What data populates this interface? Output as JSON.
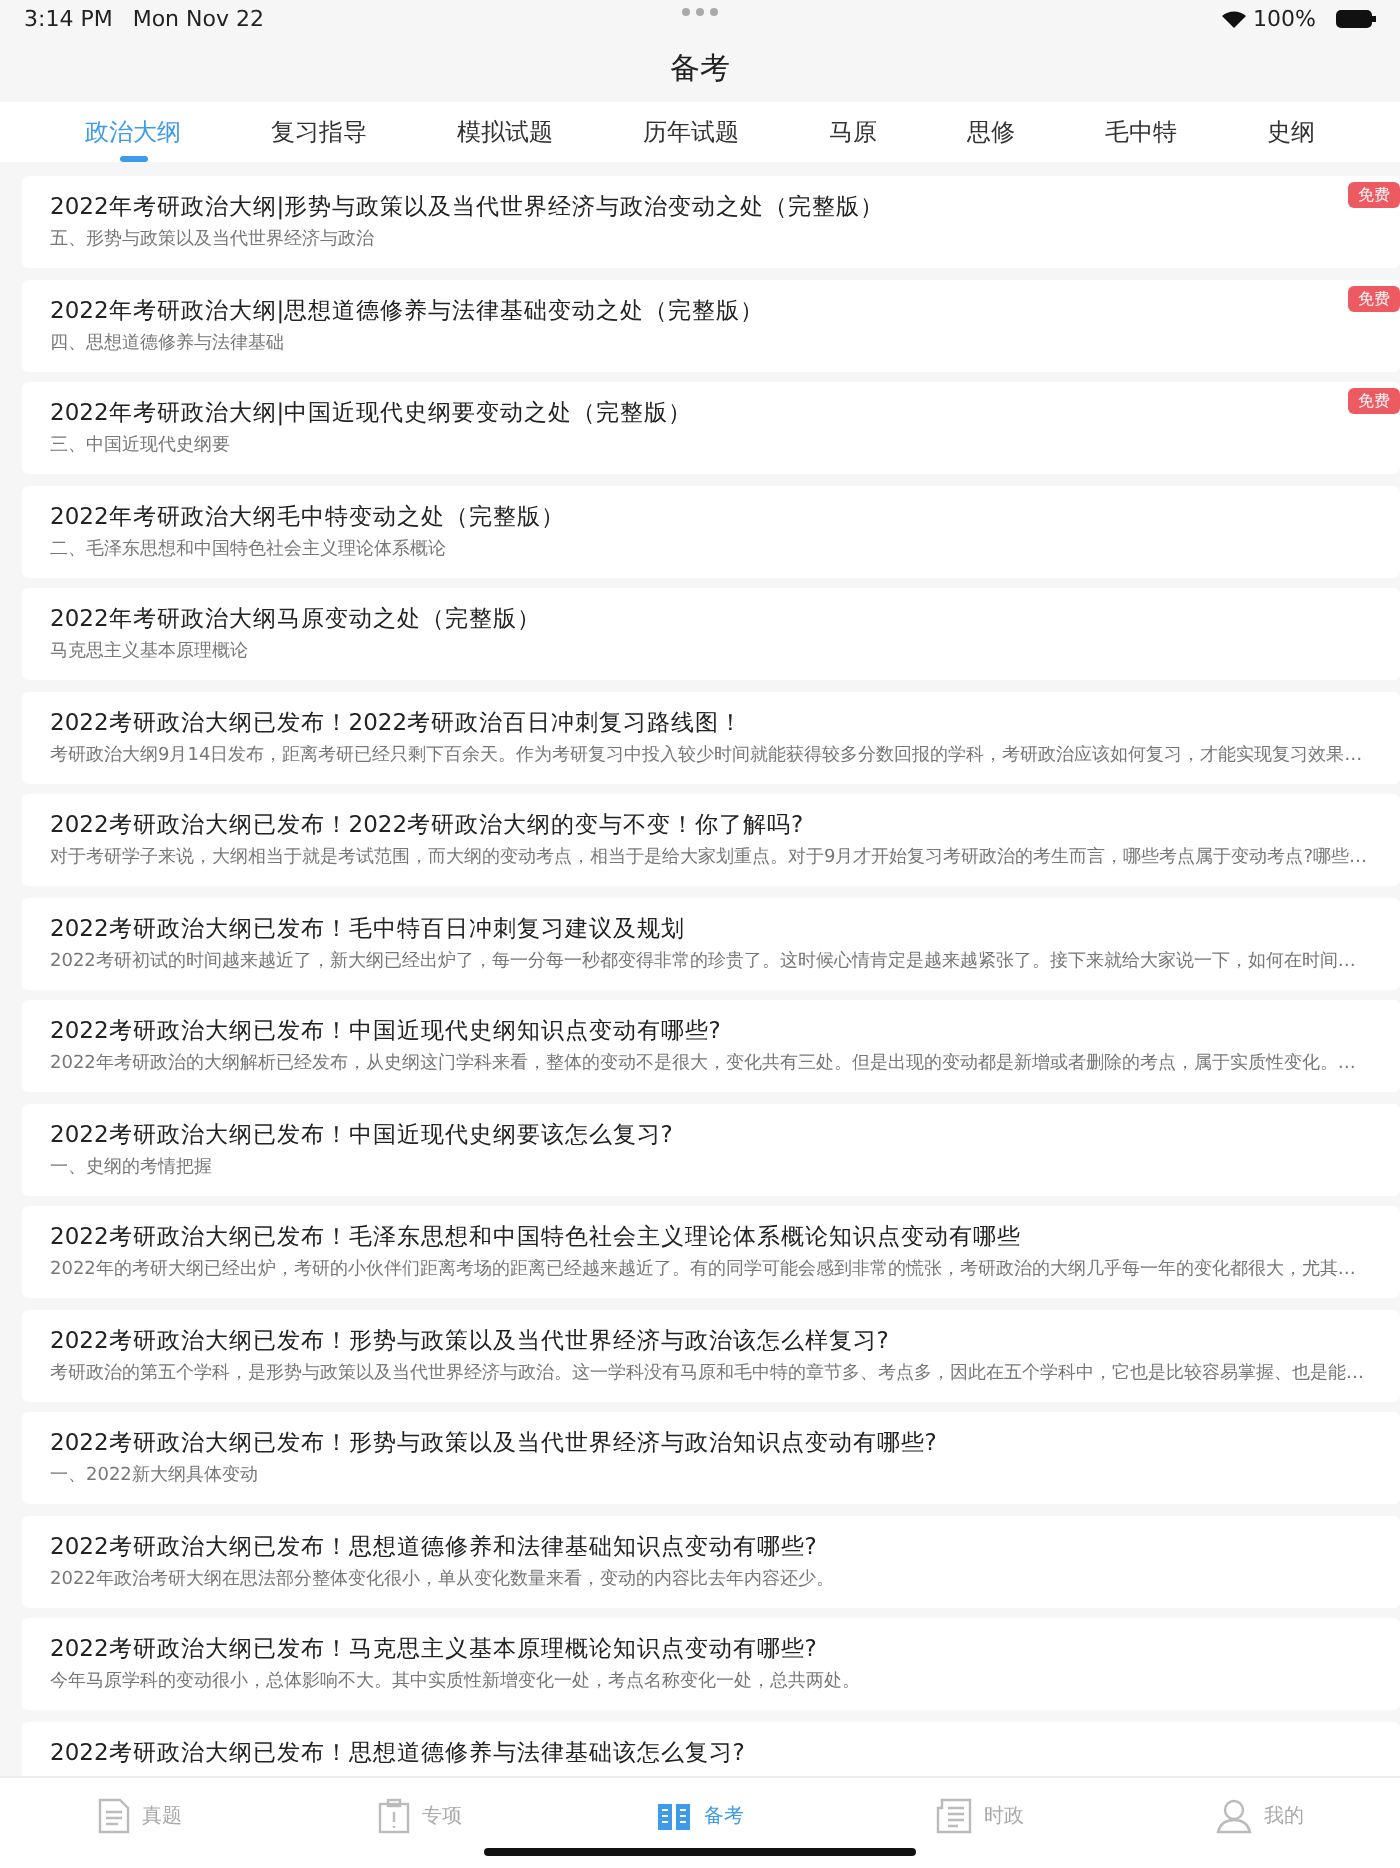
{
  "status_bar": {
    "time": "3:14 PM",
    "date": "Mon Nov 22",
    "battery": "100%"
  },
  "nav": {
    "title": "备考"
  },
  "tabs": [
    {
      "label": "政治大纲",
      "selected": true
    },
    {
      "label": "复习指导",
      "selected": false
    },
    {
      "label": "模拟试题",
      "selected": false
    },
    {
      "label": "历年试题",
      "selected": false
    },
    {
      "label": "马原",
      "selected": false
    },
    {
      "label": "思修",
      "selected": false
    },
    {
      "label": "毛中特",
      "selected": false
    },
    {
      "label": "史纲",
      "selected": false
    }
  ],
  "articles": [
    {
      "title": "2022年考研政治大纲|形势与政策以及当代世界经济与政治变动之处（完整版）",
      "summary": "五、形势与政策以及当代世界经济与政治",
      "badge": "免费"
    },
    {
      "title": "2022年考研政治大纲|思想道德修养与法律基础变动之处（完整版）",
      "summary": "四、思想道德修养与法律基础",
      "badge": "免费"
    },
    {
      "title": "2022年考研政治大纲|中国近现代史纲要变动之处（完整版）",
      "summary": "三、中国近现代史纲要",
      "badge": "免费"
    },
    {
      "title": "2022年考研政治大纲毛中特变动之处（完整版）",
      "summary": "二、毛泽东思想和中国特色社会主义理论体系概论"
    },
    {
      "title": "2022年考研政治大纲马原变动之处（完整版）",
      "summary": "马克思主义基本原理概论"
    },
    {
      "title": "2022考研政治大纲已发布！2022考研政治百日冲刺复习路线图！",
      "summary": "考研政治大纲9月14日发布，距离考研已经只剩下百余天。作为考研复习中投入较少时间就能获得较多分数回报的学科，考研政治应该如何复习，才能实现复习效果…"
    },
    {
      "title": "2022考研政治大纲已发布！2022考研政治大纲的变与不变！你了解吗?",
      "summary": "对于考研学子来说，大纲相当于就是考试范围，而大纲的变动考点，相当于是给大家划重点。对于9月才开始复习考研政治的考生而言，哪些考点属于变动考点?哪些…"
    },
    {
      "title": "2022考研政治大纲已发布！毛中特百日冲刺复习建议及规划",
      "summary": "2022考研初试的时间越来越近了，新大纲已经出炉了，每一分每一秒都变得非常的珍贵了。这时候心情肯定是越来越紧张了。接下来就给大家说一下，如何在时间…"
    },
    {
      "title": "2022考研政治大纲已发布！中国近现代史纲知识点变动有哪些?",
      "summary": "2022年考研政治的大纲解析已经发布，从史纲这门学科来看，整体的变动不是很大，变化共有三处。但是出现的变动都是新增或者删除的考点，属于实质性变化。…"
    },
    {
      "title": "2022考研政治大纲已发布！中国近现代史纲要该怎么复习?",
      "summary": "一、史纲的考情把握"
    },
    {
      "title": "2022考研政治大纲已发布！毛泽东思想和中国特色社会主义理论体系概论知识点变动有哪些",
      "summary": "2022年的考研大纲已经出炉，考研的小伙伴们距离考场的距离已经越来越近了。有的同学可能会感到非常的慌张，考研政治的大纲几乎每一年的变化都很大，尤其…"
    },
    {
      "title": "2022考研政治大纲已发布！形势与政策以及当代世界经济与政治该怎么样复习?",
      "summary": "考研政治的第五个学科，是形势与政策以及当代世界经济与政治。这一学科没有马原和毛中特的章节多、考点多，因此在五个学科中，它也是比较容易掌握、也是能…"
    },
    {
      "title": "2022考研政治大纲已发布！形势与政策以及当代世界经济与政治知识点变动有哪些?",
      "summary": "一、2022新大纲具体变动"
    },
    {
      "title": "2022考研政治大纲已发布！思想道德修养和法律基础知识点变动有哪些?",
      "summary": "2022年政治考研大纲在思法部分整体变化很小，单从变化数量来看，变动的内容比去年内容还少。"
    },
    {
      "title": "2022考研政治大纲已发布！马克思主义基本原理概论知识点变动有哪些?",
      "summary": "今年马原学科的变动很小，总体影响不大。其中实质性新增变化一处，考点名称变化一处，总共两处。"
    },
    {
      "title": "2022考研政治大纲已发布！思想道德修养与法律基础该怎么复习?"
    }
  ],
  "tab_bar": [
    {
      "label": "真题",
      "kind": "paper",
      "selected": false
    },
    {
      "label": "专项",
      "kind": "clipboard",
      "selected": false
    },
    {
      "label": "备考",
      "kind": "book",
      "selected": true
    },
    {
      "label": "时政",
      "kind": "news",
      "selected": false
    },
    {
      "label": "我的",
      "kind": "person",
      "selected": false
    }
  ]
}
